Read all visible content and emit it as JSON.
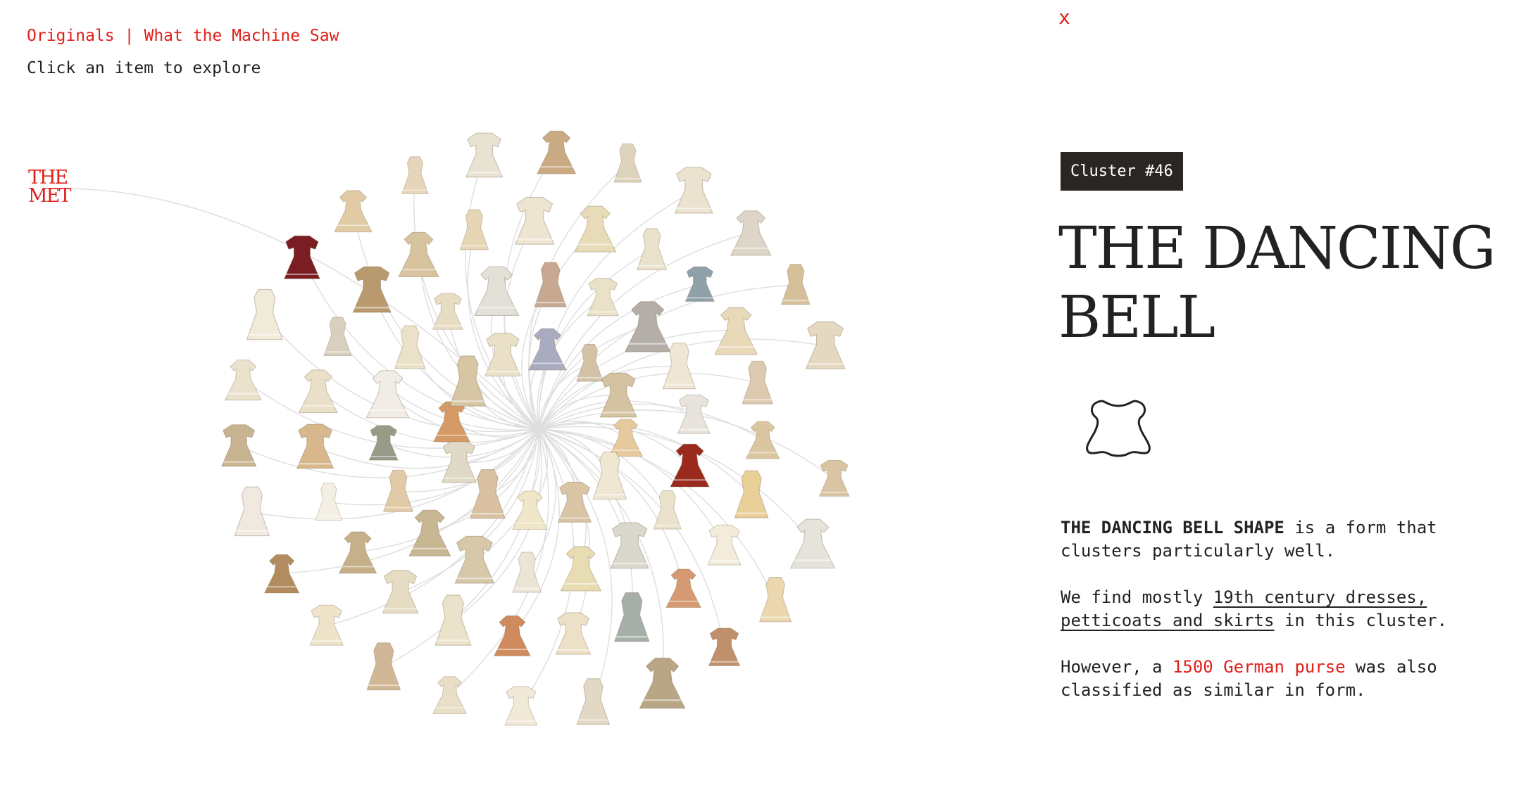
{
  "nav": {
    "originals": "Originals",
    "separator": "|",
    "machine": "What the Machine Saw"
  },
  "hint": "Click an item to explore",
  "logo": {
    "line1": "THE",
    "line2": "MET"
  },
  "close_label": "x",
  "cluster": {
    "badge": "Cluster #46",
    "title": "THE DANCING BELL",
    "shape_icon": "bell-dress-silhouette-icon"
  },
  "description": {
    "p1_bold": "THE DANCING BELL SHAPE",
    "p1_rest": " is a form that clusters particularly well.",
    "p2_pre": "We find mostly ",
    "p2_link": "19th century dresses, petticoats and skirts",
    "p2_post": " in this cluster.",
    "p3_pre": "However, a ",
    "p3_link": "1500 German purse",
    "p3_post": " was also classified as similar in form."
  },
  "colors": {
    "accent": "#e0201b",
    "badge_bg": "#2a2624",
    "garments": [
      "#efe3c8",
      "#e8d7b0",
      "#dcc8a2",
      "#f3ecdc",
      "#d7bf96",
      "#e9dcc0",
      "#cfb99a",
      "#f1e8d2",
      "#b8ad97",
      "#ead2b4"
    ]
  },
  "garments": [
    {
      "name": "dress",
      "color": "#e6c99c"
    },
    {
      "name": "dress",
      "color": "#efe7d2"
    },
    {
      "name": "dress",
      "color": "#d9c4a4"
    },
    {
      "name": "dress",
      "color": "#f0e6c8"
    },
    {
      "name": "dress",
      "color": "#d8c0a0"
    },
    {
      "name": "dress",
      "color": "#e1d9c7"
    },
    {
      "name": "dress",
      "color": "#d69a66"
    },
    {
      "name": "dress",
      "color": "#d6c6a3"
    },
    {
      "name": "dress",
      "color": "#eae0c8"
    },
    {
      "name": "dress",
      "color": "#a9acc0"
    },
    {
      "name": "dress",
      "color": "#d2c2a6"
    },
    {
      "name": "dress",
      "color": "#d4c3a0"
    },
    {
      "name": "dress",
      "color": "#9a2a1e"
    },
    {
      "name": "dress",
      "color": "#ebe2cc"
    },
    {
      "name": "dress",
      "color": "#dad8cc"
    },
    {
      "name": "dress",
      "color": "#e8dcb2"
    },
    {
      "name": "dress",
      "color": "#ebe5d6"
    },
    {
      "name": "dress",
      "color": "#d6c8a8"
    },
    {
      "name": "dress",
      "color": "#c7b793"
    },
    {
      "name": "dress",
      "color": "#e0cba6"
    },
    {
      "name": "dress",
      "color": "#9a9a88"
    },
    {
      "name": "dress",
      "color": "#f1ede6"
    },
    {
      "name": "dress",
      "color": "#ebe1c8"
    },
    {
      "name": "dress",
      "color": "#e6ddc3"
    },
    {
      "name": "dress",
      "color": "#e3e0d8"
    },
    {
      "name": "dress",
      "color": "#c8a890"
    },
    {
      "name": "dress",
      "color": "#e9e1c8"
    },
    {
      "name": "dress",
      "color": "#b3aea8"
    },
    {
      "name": "dress",
      "color": "#efe6d5"
    },
    {
      "name": "dress",
      "color": "#e8e4dd"
    },
    {
      "name": "dress",
      "color": "#dbc6a2"
    },
    {
      "name": "dress",
      "color": "#e9cf98"
    },
    {
      "name": "dress",
      "color": "#f3ecdd"
    },
    {
      "name": "dress",
      "color": "#d59a72"
    },
    {
      "name": "dress",
      "color": "#a6b0a8"
    },
    {
      "name": "dress",
      "color": "#ece1c6"
    },
    {
      "name": "dress",
      "color": "#cf8a5e"
    },
    {
      "name": "dress",
      "color": "#ebe2cb"
    },
    {
      "name": "dress",
      "color": "#e6dcc4"
    },
    {
      "name": "dress",
      "color": "#c6b08a"
    },
    {
      "name": "dress",
      "color": "#f4efe4"
    },
    {
      "name": "dress",
      "color": "#d9b78d"
    },
    {
      "name": "dress",
      "color": "#eadfc8"
    },
    {
      "name": "dress",
      "color": "#d8cfbf"
    },
    {
      "name": "dress",
      "color": "#b99a6e"
    },
    {
      "name": "dress",
      "color": "#d8c39f"
    },
    {
      "name": "dress",
      "color": "#e6d6b6"
    },
    {
      "name": "dress",
      "color": "#eee5d0"
    },
    {
      "name": "dress",
      "color": "#e8dbb8"
    },
    {
      "name": "dress",
      "color": "#eae1cc"
    },
    {
      "name": "dress",
      "color": "#8fa0a8"
    },
    {
      "name": "dress",
      "color": "#e8d9b8"
    },
    {
      "name": "dress",
      "color": "#dcc9b0"
    },
    {
      "name": "dress",
      "color": "#d9c5a3"
    },
    {
      "name": "dress",
      "color": "#e6e4da"
    },
    {
      "name": "dress",
      "color": "#ecd8b0"
    },
    {
      "name": "dress",
      "color": "#c0906c"
    },
    {
      "name": "dress",
      "color": "#b8a685"
    },
    {
      "name": "dress",
      "color": "#e3d8c4"
    },
    {
      "name": "dress",
      "color": "#f0e9d8"
    },
    {
      "name": "dress",
      "color": "#e8dfc6"
    },
    {
      "name": "dress",
      "color": "#d1b795"
    },
    {
      "name": "dress",
      "color": "#efe3ca"
    },
    {
      "name": "dress",
      "color": "#b28c60"
    },
    {
      "name": "dress",
      "color": "#efe9e0"
    },
    {
      "name": "dress",
      "color": "#c8b490"
    },
    {
      "name": "dress",
      "color": "#ebe2cd"
    },
    {
      "name": "dress",
      "color": "#f0ead8"
    },
    {
      "name": "dress",
      "color": "#7a1e24"
    },
    {
      "name": "dress",
      "color": "#e0cba4"
    },
    {
      "name": "dress",
      "color": "#e6d5b8"
    },
    {
      "name": "dress",
      "color": "#e8e2d2"
    },
    {
      "name": "dress",
      "color": "#c9aa82"
    },
    {
      "name": "dress",
      "color": "#ded3bd"
    },
    {
      "name": "dress",
      "color": "#ebe2cf"
    },
    {
      "name": "dress",
      "color": "#dcd5c8"
    },
    {
      "name": "dress",
      "color": "#d5c09a"
    },
    {
      "name": "dress",
      "color": "#e4d9c0"
    }
  ]
}
